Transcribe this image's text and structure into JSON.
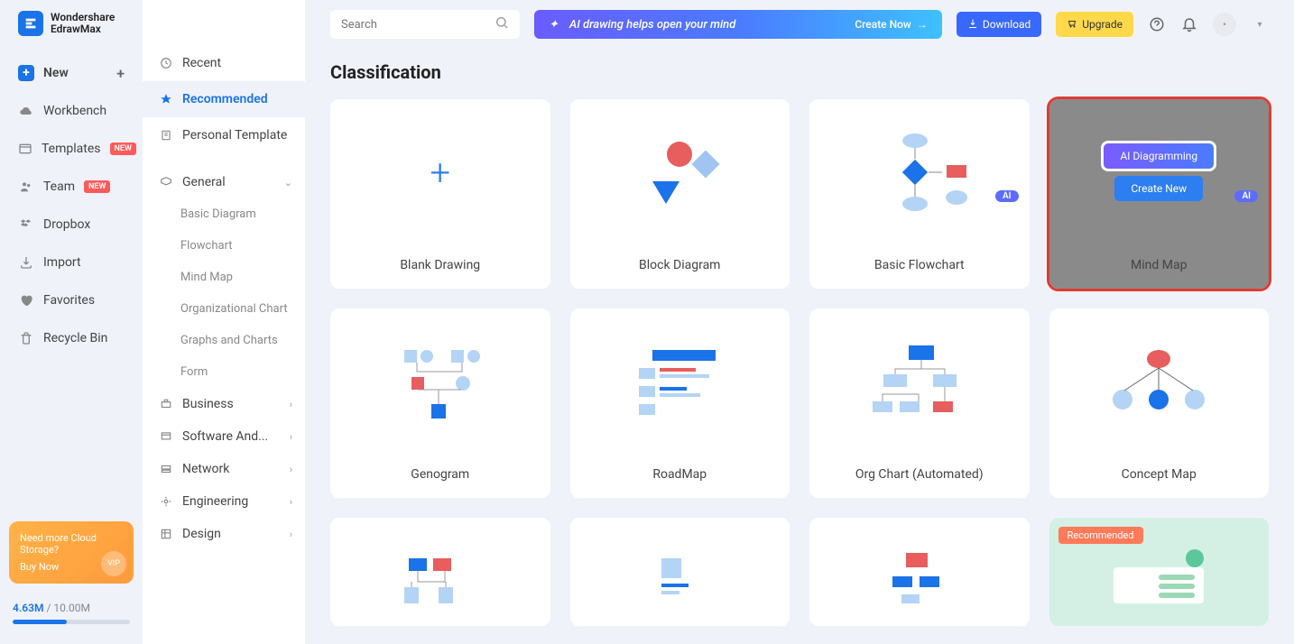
{
  "app": {
    "name1": "Wondershare",
    "name2": "EdrawMax"
  },
  "primaryNav": {
    "new": "New",
    "workbench": "Workbench",
    "templates": "Templates",
    "team": "Team",
    "dropbox": "Dropbox",
    "import": "Import",
    "favorites": "Favorites",
    "recycle": "Recycle Bin",
    "badge_new": "NEW"
  },
  "cloudPromo": {
    "title": "Need more Cloud Storage?",
    "buy": "Buy Now",
    "vip": "VIP"
  },
  "storage": {
    "used": "4.63M",
    "sep": " / ",
    "total": "10.00M"
  },
  "secondaryNav": {
    "recent": "Recent",
    "recommended": "Recommended",
    "personal": "Personal Template"
  },
  "categories": {
    "general": "General",
    "general_items": {
      "basic": "Basic Diagram",
      "flowchart": "Flowchart",
      "mindmap": "Mind Map",
      "orgchart": "Organizational Chart",
      "graphs": "Graphs and Charts",
      "form": "Form"
    },
    "business": "Business",
    "software": "Software And...",
    "network": "Network",
    "engineering": "Engineering",
    "design": "Design"
  },
  "topbar": {
    "search_placeholder": "Search",
    "ai_banner": "AI drawing helps open your mind",
    "create_now": "Create Now",
    "download": "Download",
    "upgrade": "Upgrade"
  },
  "section": {
    "title": "Classification"
  },
  "cards": {
    "blank": "Blank Drawing",
    "block": "Block Diagram",
    "basic_flow": "Basic Flowchart",
    "mindmap": "Mind Map",
    "genogram": "Genogram",
    "roadmap": "RoadMap",
    "orgchart": "Org Chart (Automated)",
    "concept": "Concept Map",
    "ai_tag": "AI",
    "recommended_tag": "Recommended",
    "hover_ai": "AI Diagramming",
    "hover_create": "Create New"
  }
}
